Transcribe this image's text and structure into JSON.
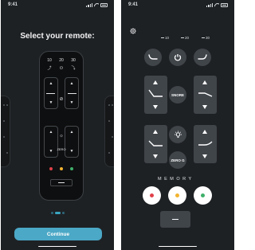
{
  "status": {
    "time": "9:41"
  },
  "onboarding": {
    "title": "Select your remote:",
    "remote_position_labels": [
      "10",
      "20",
      "30"
    ],
    "remote_snore_label": "SNORE",
    "remote_zerog_label": "ZERO",
    "pager": {
      "pages": 3,
      "current": 2
    },
    "continue_label": "Continue"
  },
  "remote_screen": {
    "position_labels": [
      "10",
      "20",
      "30"
    ],
    "snore_label": "SNORE",
    "zero_g_label": "ZERO G",
    "memory_label": "MEMORY",
    "memory_colors": [
      "#e0424b",
      "#f2b430",
      "#3faf6a"
    ]
  },
  "colors": {
    "accent": "#4ba8c6",
    "background": "#1e2124",
    "button": "#40454a"
  }
}
